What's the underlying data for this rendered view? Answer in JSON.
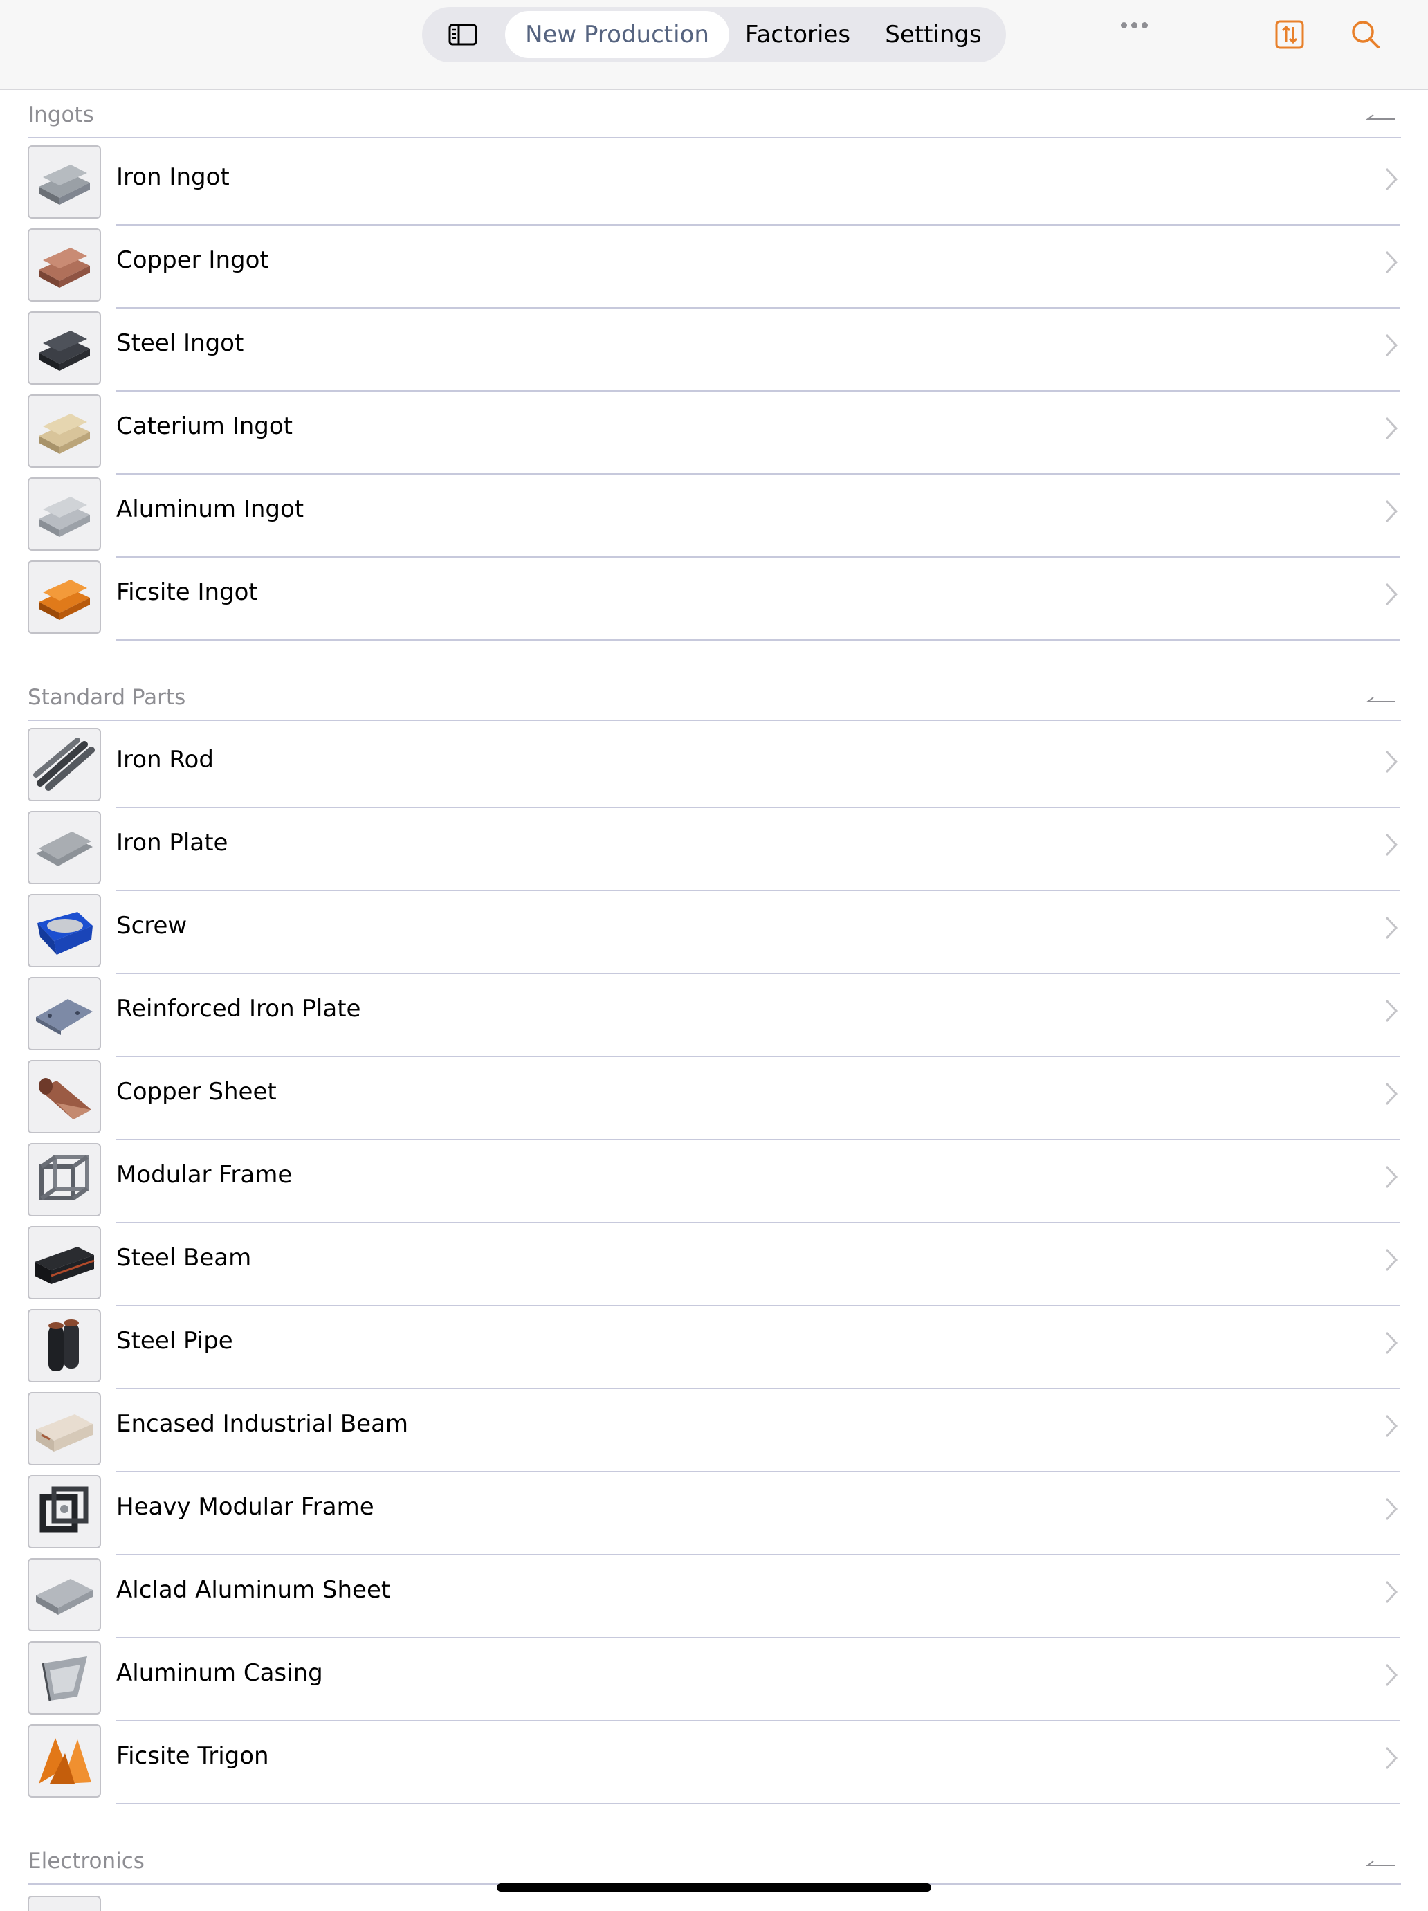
{
  "toolbar": {
    "tabs": [
      {
        "label": "New Production",
        "active": true
      },
      {
        "label": "Factories",
        "active": false
      },
      {
        "label": "Settings",
        "active": false
      }
    ],
    "left_icon": "sidebar-toggle-icon",
    "right_icons": [
      "sort-icon",
      "search-icon"
    ],
    "accent_color": "#e8802a"
  },
  "sections": [
    {
      "title": "Ingots",
      "items": [
        {
          "label": "Iron Ingot",
          "icon": "iron-ingot-icon"
        },
        {
          "label": "Copper Ingot",
          "icon": "copper-ingot-icon"
        },
        {
          "label": "Steel Ingot",
          "icon": "steel-ingot-icon"
        },
        {
          "label": "Caterium Ingot",
          "icon": "caterium-ingot-icon"
        },
        {
          "label": "Aluminum Ingot",
          "icon": "aluminum-ingot-icon"
        },
        {
          "label": "Ficsite Ingot",
          "icon": "ficsite-ingot-icon"
        }
      ]
    },
    {
      "title": "Standard Parts",
      "items": [
        {
          "label": "Iron Rod",
          "icon": "iron-rod-icon"
        },
        {
          "label": "Iron Plate",
          "icon": "iron-plate-icon"
        },
        {
          "label": "Screw",
          "icon": "screw-icon"
        },
        {
          "label": "Reinforced Iron Plate",
          "icon": "reinforced-iron-plate-icon"
        },
        {
          "label": "Copper Sheet",
          "icon": "copper-sheet-icon"
        },
        {
          "label": "Modular Frame",
          "icon": "modular-frame-icon"
        },
        {
          "label": "Steel Beam",
          "icon": "steel-beam-icon"
        },
        {
          "label": "Steel Pipe",
          "icon": "steel-pipe-icon"
        },
        {
          "label": "Encased Industrial Beam",
          "icon": "encased-industrial-beam-icon"
        },
        {
          "label": "Heavy Modular Frame",
          "icon": "heavy-modular-frame-icon"
        },
        {
          "label": "Alclad Aluminum Sheet",
          "icon": "alclad-aluminum-sheet-icon"
        },
        {
          "label": "Aluminum Casing",
          "icon": "aluminum-casing-icon"
        },
        {
          "label": "Ficsite Trigon",
          "icon": "ficsite-trigon-icon"
        }
      ]
    },
    {
      "title": "Electronics",
      "items": []
    }
  ]
}
